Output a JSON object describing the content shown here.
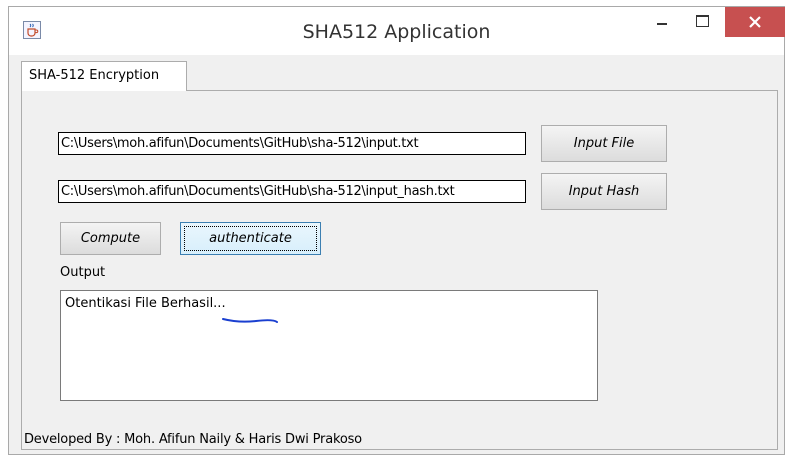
{
  "window": {
    "title": "SHA512 Application"
  },
  "tabs": [
    {
      "label": "SHA-512 Encryption"
    }
  ],
  "form": {
    "input_file_path": "C:\\Users\\moh.afifun\\Documents\\GitHub\\sha-512\\input.txt",
    "input_hash_path": "C:\\Users\\moh.afifun\\Documents\\GitHub\\sha-512\\input_hash.txt",
    "input_file_label": "Input File",
    "input_hash_label": "Input Hash",
    "compute_label": "Compute",
    "authenticate_label": "authenticate"
  },
  "output": {
    "label": "Output",
    "text": "Otentikasi File Berhasil..."
  },
  "footer": {
    "credits": "Developed By : Moh. Afifun Naily & Haris Dwi Prakoso"
  },
  "icons": {
    "app": "java-cup-icon",
    "minimize": "minimize-icon",
    "maximize": "maximize-icon",
    "close": "close-icon"
  },
  "colors": {
    "close_button": "#c75050",
    "focus_border": "#3c7fb1",
    "annotation_stroke": "#1a3fd0"
  }
}
